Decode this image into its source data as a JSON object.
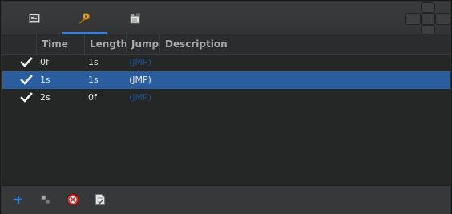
{
  "tabs": [
    {
      "icon": "image-icon",
      "active": false
    },
    {
      "icon": "key-icon",
      "active": true
    },
    {
      "icon": "clip-icon",
      "active": false
    }
  ],
  "table": {
    "columns": [
      "Time",
      "Length",
      "Jump",
      "Description"
    ],
    "rows": [
      {
        "checked": true,
        "time": "0f",
        "length": "1s",
        "jump": "(JMP)",
        "description": "",
        "selected": false
      },
      {
        "checked": true,
        "time": "1s",
        "length": "1s",
        "jump": "(JMP)",
        "description": "",
        "selected": true
      },
      {
        "checked": true,
        "time": "2s",
        "length": "0f",
        "jump": "(JMP)",
        "description": "",
        "selected": false
      }
    ]
  },
  "footer": {
    "buttons": [
      "add-icon",
      "duplicate-icon",
      "remove-icon",
      "notes-icon"
    ]
  },
  "colors": {
    "accent": "#3c7fd1",
    "selection": "#2a5e9f",
    "remove": "#d12a2a"
  }
}
